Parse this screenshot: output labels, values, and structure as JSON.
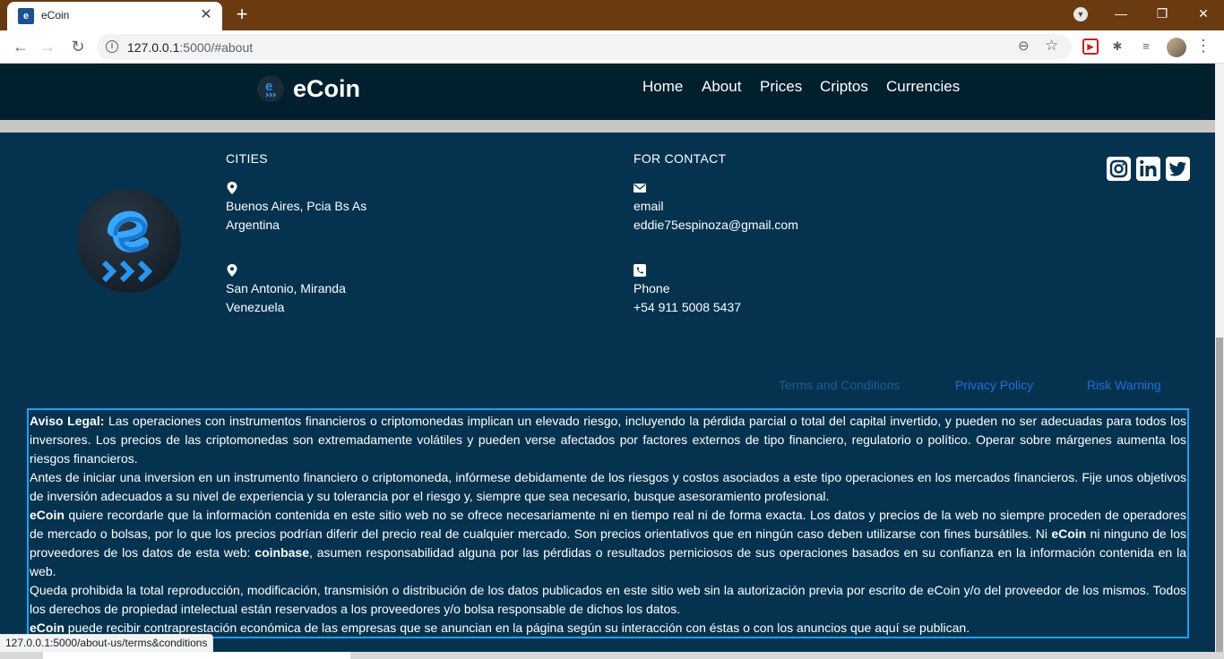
{
  "browser": {
    "tab_title": "eCoin",
    "url_host": "127.0.0.1",
    "url_rest": ":5000/#about",
    "status_url": "127.0.0.1:5000/about-us/terms&conditions"
  },
  "header": {
    "brand": "eCoin",
    "nav": [
      "Home",
      "About",
      "Prices",
      "Criptos",
      "Currencies"
    ]
  },
  "footer": {
    "cities_heading": "CITIES",
    "contact_heading": "FOR CONTACT",
    "city1": {
      "line1": "Buenos Aires, Pcia Bs As",
      "line2": "Argentina"
    },
    "city2": {
      "line1": "San Antonio, Miranda",
      "line2": "Venezuela"
    },
    "email": {
      "label": "email",
      "value": "eddie75espinoza@gmail.com"
    },
    "phone": {
      "label": "Phone",
      "value": "+54 911 5008 5437"
    },
    "social": [
      "instagram-icon",
      "linkedin-icon",
      "twitter-icon"
    ],
    "links": {
      "terms": "Terms and Conditions",
      "privacy": "Privacy Policy",
      "risk": "Risk Warning"
    }
  },
  "disclaimer": {
    "p1_bold": "Aviso Legal:",
    "p1_text": " Las operaciones con instrumentos financieros o criptomonedas implican un elevado riesgo, incluyendo la pérdida parcial o total del capital invertido, y pueden no ser adecuadas para todos los inversores. Los precios de las criptomonedas son extremadamente volátiles y pueden verse afectados por factores externos de tipo financiero, regulatorio o político. Operar sobre márgenes aumenta los riesgos financieros.",
    "p2_text": "Antes de iniciar una inversion en un instrumento financiero o criptomoneda, infórmese debidamente de los riesgos y costos asociados a este tipo operaciones en los mercados financieros. Fije unos objetivos de inversión adecuados a su nivel de experiencia y su tolerancia por el riesgo y, siempre que sea necesario, busque asesoramiento profesional.",
    "p3_bold1": "eCoin",
    "p3_text1": " quiere recordarle que la información contenida en este sitio web no se ofrece necesariamente ni en tiempo real ni de forma exacta. Los datos y precios de la web no siempre proceden de operadores de mercado o bolsas, por lo que los precios podrían diferir del precio real de cualquier mercado. Son precios orientativos que en ningún caso deben utilizarse con fines bursátiles. Ni ",
    "p3_bold2": "eCoin",
    "p3_text2": " ni ninguno de los proveedores de los datos de esta web: ",
    "p3_bold3": "coinbase",
    "p3_text3": ", asumen responsabilidad alguna por las pérdidas o resultados perniciosos de sus operaciones basados en su confianza en la información contenida en la web.",
    "p4_text": "Queda prohibida la total reproducción, modificación, transmisión o distribución de los datos publicados en este sitio web sin la autorización previa por escrito de eCoin y/o del proveedor de los mismos. Todos los derechos de propiedad intelectual están reservados a los proveedores y/o bolsa responsable de dichos los datos.",
    "p5_bold": "eCoin",
    "p5_text": " puede recibir contraprestación económica de las empresas que se anuncian en la página según su interacción con éstas o con los anuncios que aquí se publican."
  },
  "colors": {
    "page_bg": "#05334f",
    "header_bg": "#00202e",
    "link_blue": "#1e6fd9",
    "link_dim": "#1b5a99",
    "border_blue": "#1da1f2"
  }
}
